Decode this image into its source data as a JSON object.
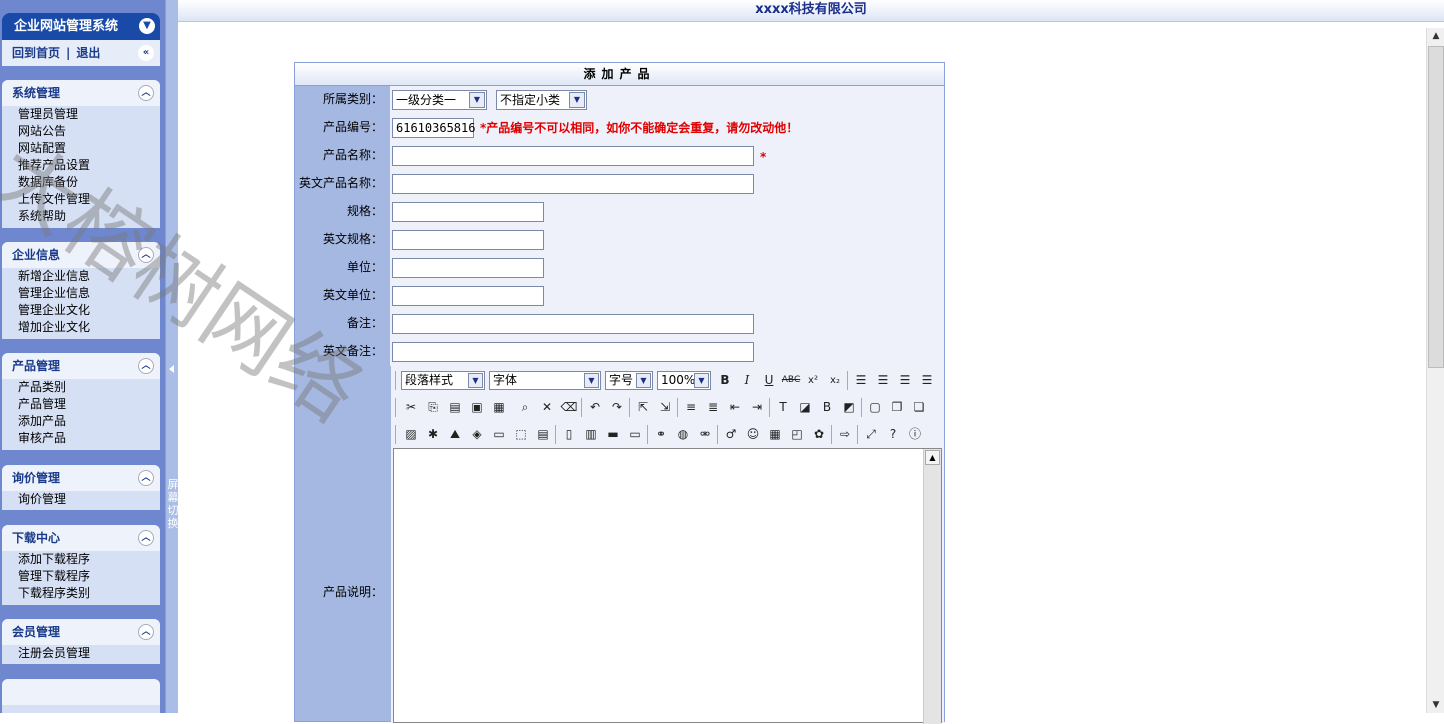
{
  "sidebar": {
    "title": "企业网站管理系统",
    "home_link": "回到首页",
    "logout_link": "退出",
    "groups": [
      {
        "title": "系统管理",
        "items": [
          "管理员管理",
          "网站公告",
          "网站配置",
          "推荐产品设置",
          "数据库备份",
          "上传文件管理",
          "系统帮助"
        ]
      },
      {
        "title": "企业信息",
        "items": [
          "新增企业信息",
          "管理企业信息",
          "管理企业文化",
          "增加企业文化"
        ]
      },
      {
        "title": "产品管理",
        "items": [
          "产品类别",
          "产品管理",
          "添加产品",
          "审核产品"
        ]
      },
      {
        "title": "询价管理",
        "items": [
          "询价管理"
        ]
      },
      {
        "title": "下载中心",
        "items": [
          "添加下载程序",
          "管理下载程序",
          "下载程序类别"
        ]
      },
      {
        "title": "会员管理",
        "items": [
          "注册会员管理"
        ]
      }
    ]
  },
  "splitter": {
    "switch_label": "屏幕切换"
  },
  "header": {
    "company": "xxxx科技有限公司"
  },
  "form": {
    "title": "添加产品",
    "category_label": "所属类别：",
    "category_value": "一级分类一",
    "subcategory_value": "不指定小类",
    "code_label": "产品编号：",
    "code_value": "61610365816",
    "code_note": "*产品编号不可以相同，如你不能确定会重复，请勿改动他！",
    "name_label": "产品名称：",
    "name_star": "*",
    "en_name_label": "英文产品名称：",
    "spec_label": "规格：",
    "en_spec_label": "英文规格：",
    "unit_label": "单位：",
    "en_unit_label": "英文单位：",
    "remark_label": "备注：",
    "en_remark_label": "英文备注：",
    "desc_label": "产品说明："
  },
  "editor": {
    "paragraph_style": "段落样式",
    "font": "字体",
    "font_size": "字号",
    "zoom": "100%"
  },
  "watermark": "大榕树网络"
}
